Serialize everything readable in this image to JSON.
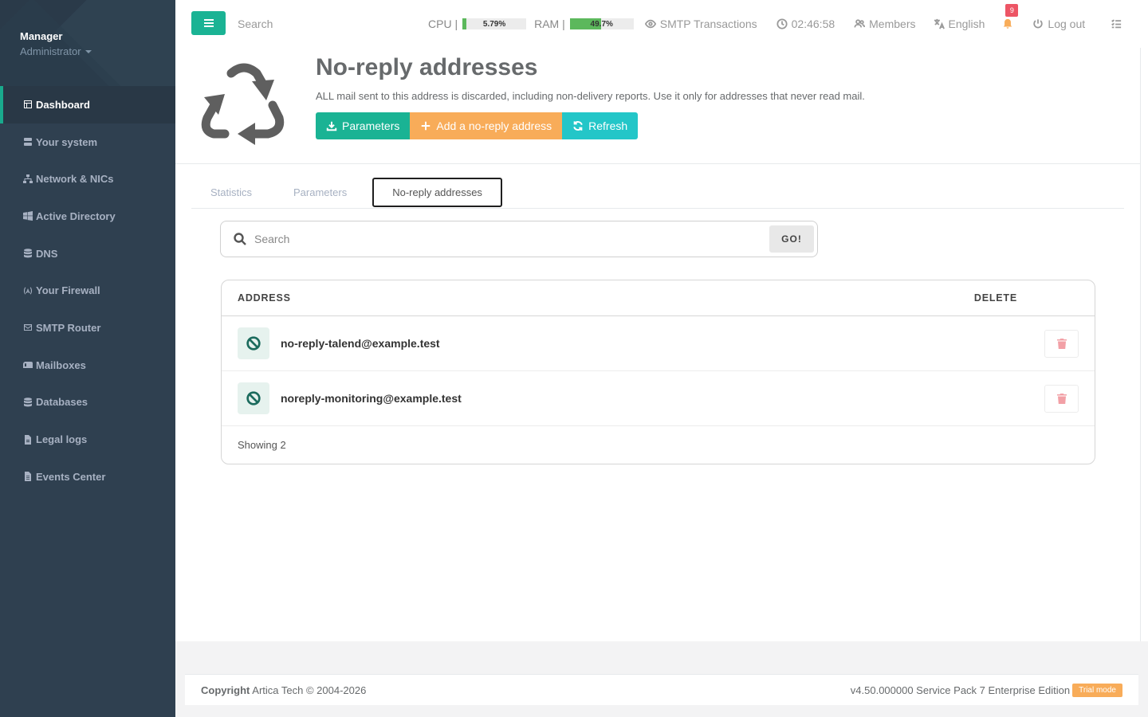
{
  "profile": {
    "name": "Manager",
    "role": "Administrator"
  },
  "sidebar": {
    "items": [
      {
        "label": "Dashboard",
        "icon": "dashboard-icon"
      },
      {
        "label": "Your system",
        "icon": "server-icon"
      },
      {
        "label": "Network & NICs",
        "icon": "network-icon"
      },
      {
        "label": "Active Directory",
        "icon": "windows-icon"
      },
      {
        "label": "DNS",
        "icon": "database-icon"
      },
      {
        "label": "Your Firewall",
        "icon": "firewall-icon"
      },
      {
        "label": "SMTP Router",
        "icon": "envelope-icon"
      },
      {
        "label": "Mailboxes",
        "icon": "mailbox-icon"
      },
      {
        "label": "Databases",
        "icon": "database-icon"
      },
      {
        "label": "Legal logs",
        "icon": "file-icon"
      },
      {
        "label": "Events Center",
        "icon": "file-text-icon"
      }
    ]
  },
  "topbar": {
    "search_placeholder": "Search",
    "cpu_label": "CPU |",
    "cpu_value": "5.79%",
    "cpu_percent": 5.79,
    "ram_label": "RAM |",
    "ram_value": "49.7%",
    "ram_percent": 49.7,
    "smtp_label": "SMTP Transactions",
    "clock": "02:46:58",
    "members_label": "Members",
    "language": "English",
    "notifications_count": "9",
    "logout_label": "Log out"
  },
  "page": {
    "title": "No-reply addresses",
    "description": "ALL mail sent to this address is discarded, including non-delivery reports. Use it only for addresses that never read mail.",
    "buttons": {
      "parameters": "Parameters",
      "add": "Add a no-reply address",
      "refresh": "Refresh"
    }
  },
  "tabs": [
    {
      "label": "Statistics",
      "active": false
    },
    {
      "label": "Parameters",
      "active": false
    },
    {
      "label": "No-reply addresses",
      "active": true
    }
  ],
  "search": {
    "placeholder": "Search",
    "go_label": "GO!"
  },
  "table": {
    "col_address": "ADDRESS",
    "col_delete": "DELETE",
    "rows": [
      {
        "address": "no-reply-talend@example.test"
      },
      {
        "address": "noreply-monitoring@example.test"
      }
    ],
    "footer": "Showing 2"
  },
  "footer": {
    "copyright_label": "Copyright",
    "copyright_text": "Artica Tech © 2004-2026",
    "version": "v4.50.000000 Service Pack 7 Enterprise Edition",
    "trial": "Trial mode"
  },
  "colors": {
    "sidebar_bg": "#2f4050",
    "accent_green": "#1ab394",
    "accent_orange": "#f8ac59",
    "accent_teal": "#23c6c8",
    "danger": "#ed5565"
  }
}
